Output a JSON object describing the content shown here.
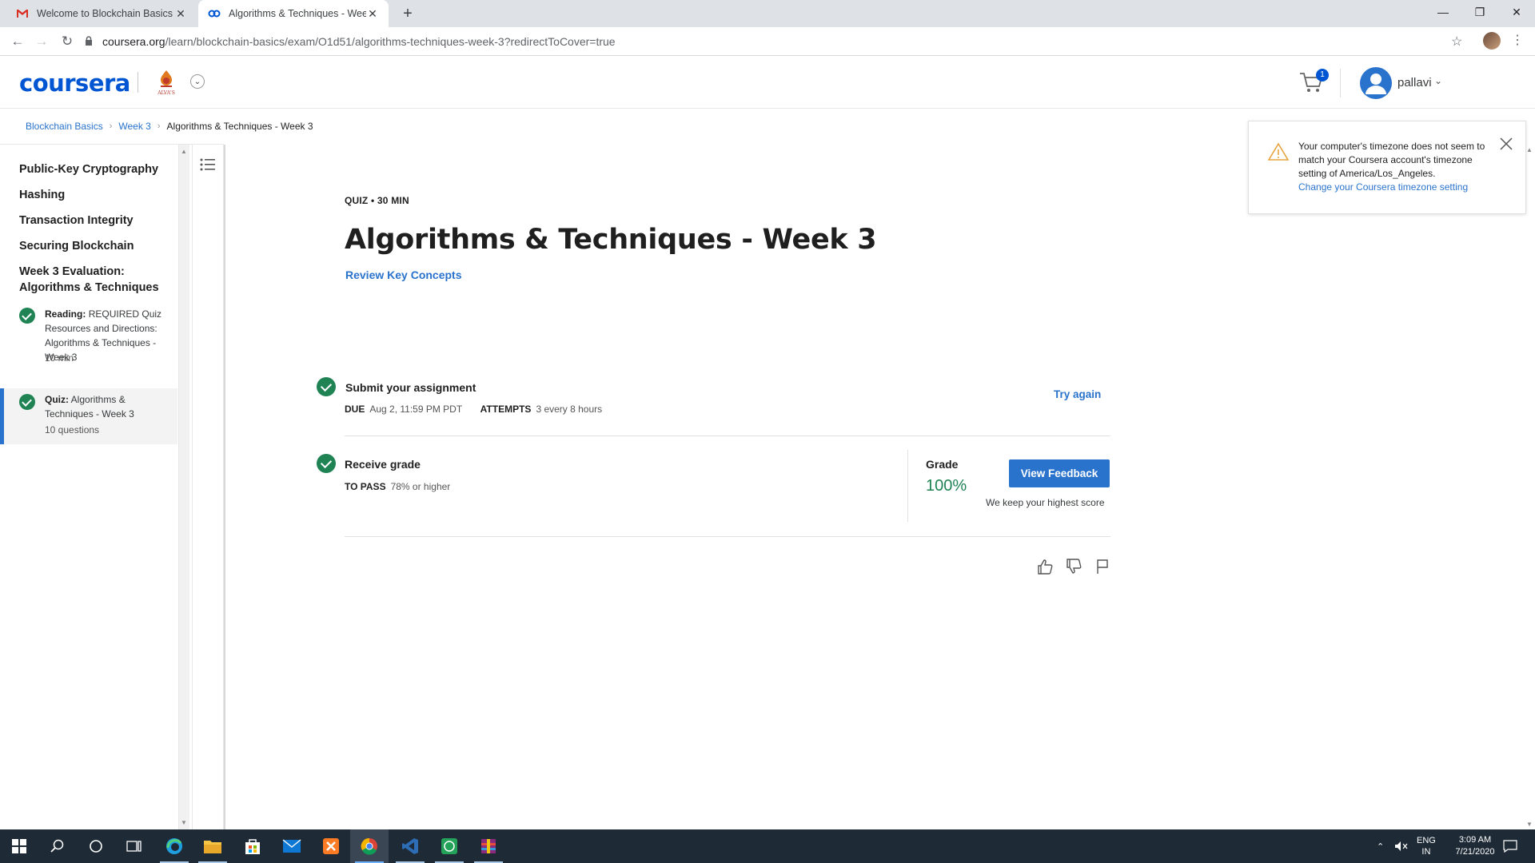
{
  "browser": {
    "tabs": [
      {
        "title": "Welcome to Blockchain Basics - B",
        "icon": "gmail-icon"
      },
      {
        "title": "Algorithms & Techniques - Week",
        "icon": "coursera-icon"
      }
    ],
    "url_host": "coursera.org",
    "url_path": "/learn/blockchain-basics/exam/O1d51/algorithms-techniques-week-3?redirectToCover=true"
  },
  "header": {
    "logo": "coursera",
    "university_logo_label": "ALVA'S",
    "cart_count": "1",
    "username": "pallavi"
  },
  "breadcrumb": [
    "Blockchain Basics",
    "Week 3",
    "Algorithms & Techniques - Week 3"
  ],
  "sidebar": {
    "items": [
      "Public-Key Cryptography",
      "Hashing",
      "Transaction Integrity",
      "Securing Blockchain",
      "Week 3 Evaluation: Algorithms & Techniques"
    ],
    "subitems": [
      {
        "type": "Reading:",
        "title": "REQUIRED Quiz Resources and Directions: Algorithms & Techniques - Week 3",
        "meta": "10 min"
      },
      {
        "type": "Quiz:",
        "title": "Algorithms & Techniques - Week 3",
        "meta": "10 questions"
      }
    ]
  },
  "main": {
    "eyebrow": "QUIZ • 30 MIN",
    "title": "Algorithms & Techniques - Week 3",
    "review_link": "Review Key Concepts",
    "submit": {
      "title": "Submit your assignment",
      "due_label": "DUE",
      "due_value": "Aug 2, 11:59 PM PDT",
      "attempts_label": "ATTEMPTS",
      "attempts_value": "3 every 8 hours",
      "action": "Try again"
    },
    "receive": {
      "title": "Receive grade",
      "pass_label": "TO PASS",
      "pass_value": "78% or higher",
      "grade_label": "Grade",
      "grade_value": "100%",
      "button": "View Feedback",
      "note": "We keep your highest score"
    }
  },
  "toast": {
    "message": "Your computer's timezone does not seem to match your Coursera account's timezone setting of America/Los_Angeles.",
    "link": "Change your Coursera timezone setting"
  },
  "taskbar": {
    "language": "ENG",
    "region": "IN",
    "time": "3:09 AM",
    "date": "7/21/2020"
  },
  "colors": {
    "brand": "#0056d2",
    "link": "#2a73cc",
    "success": "#1f8354"
  }
}
